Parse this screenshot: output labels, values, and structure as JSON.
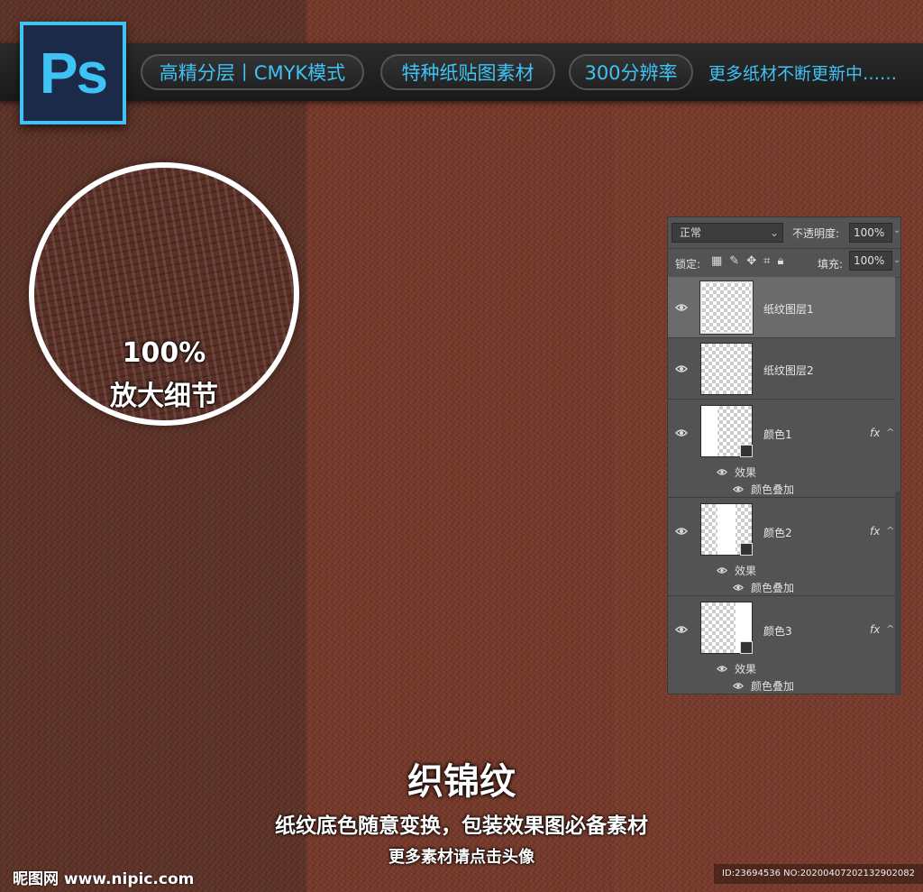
{
  "banner": {
    "logo_text": "Ps",
    "pills": [
      "高精分层丨CMYK模式",
      "特种纸贴图素材",
      "300分辨率"
    ],
    "more": "更多纸材不断更新中……"
  },
  "zoom": {
    "percent": "100%",
    "label": "放大细节"
  },
  "layers_panel": {
    "blend_mode": "正常",
    "opacity_label": "不透明度:",
    "opacity_value": "100%",
    "lock_label": "锁定:",
    "fill_label": "填充:",
    "fill_value": "100%",
    "layers": [
      {
        "name": "纸纹图层1",
        "selected": true
      },
      {
        "name": "纸纹图层2",
        "selected": false
      },
      {
        "name": "颜色1",
        "fx": "fx",
        "effects_label": "效果",
        "effect_item": "颜色叠加"
      },
      {
        "name": "颜色2",
        "fx": "fx",
        "effects_label": "效果",
        "effect_item": "颜色叠加"
      },
      {
        "name": "颜色3",
        "fx": "fx",
        "effects_label": "效果",
        "effect_item": "颜色叠加"
      }
    ]
  },
  "title": "织锦纹",
  "subtitle": "纸纹底色随意变换，包装效果图必备素材",
  "note": "更多素材请点击头像",
  "watermark": "昵图网 www.nipic.com",
  "image_id": "ID:23694536 NO:20200407202132902082",
  "colors": {
    "accent": "#3fc3f5",
    "panel_bg": "#535353"
  }
}
